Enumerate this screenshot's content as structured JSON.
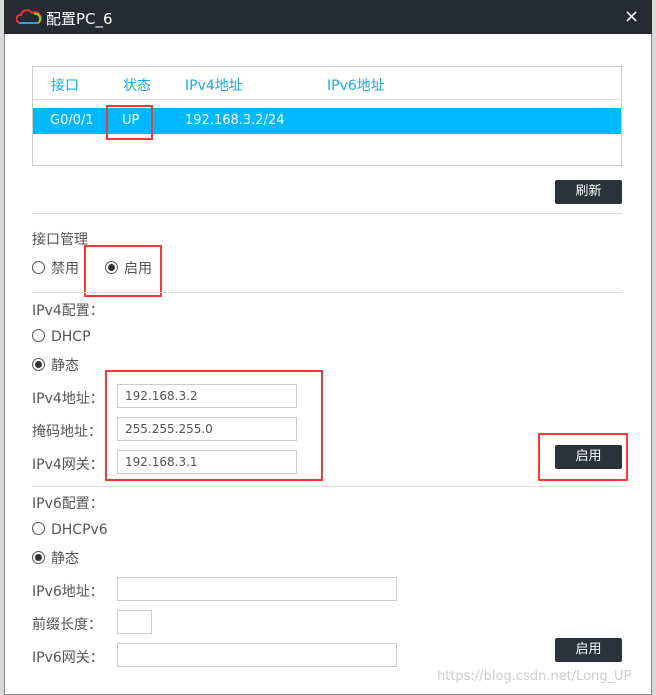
{
  "window": {
    "title": "配置PC_6",
    "close_label": "×",
    "icon": "cloud-logo-icon"
  },
  "table": {
    "headers": [
      "接口",
      "状态",
      "IPv4地址",
      "IPv6地址"
    ],
    "rows": [
      {
        "interface": "G0/0/1",
        "status": "UP",
        "ipv4": "192.168.3.2/24",
        "ipv6": ""
      }
    ]
  },
  "refresh_label": "刷新",
  "interface_mgmt": {
    "title": "接口管理",
    "options": [
      "禁用",
      "启用"
    ],
    "selected": "启用"
  },
  "ipv4": {
    "title": "IPv4配置：",
    "options": [
      "DHCP",
      "静态"
    ],
    "selected": "静态",
    "address_label": "IPv4地址：",
    "address": "192.168.3.2",
    "mask_label": "掩码地址：",
    "mask": "255.255.255.0",
    "gateway_label": "IPv4网关：",
    "gateway": "192.168.3.1",
    "apply_label": "启用"
  },
  "ipv6": {
    "title": "IPv6配置：",
    "options": [
      "DHCPv6",
      "静态"
    ],
    "selected": "静态",
    "address_label": "IPv6地址：",
    "address": "",
    "prefix_label": "前缀长度：",
    "prefix": "",
    "gateway_label": "IPv6网关：",
    "gateway": "",
    "apply_label": "启用"
  },
  "watermark": "https://blog.csdn.net/Long_UP",
  "colors": {
    "titlebar": "#252a33",
    "accent": "#00b8ff",
    "highlight": "#f03b3b",
    "button": "#2c323c"
  }
}
